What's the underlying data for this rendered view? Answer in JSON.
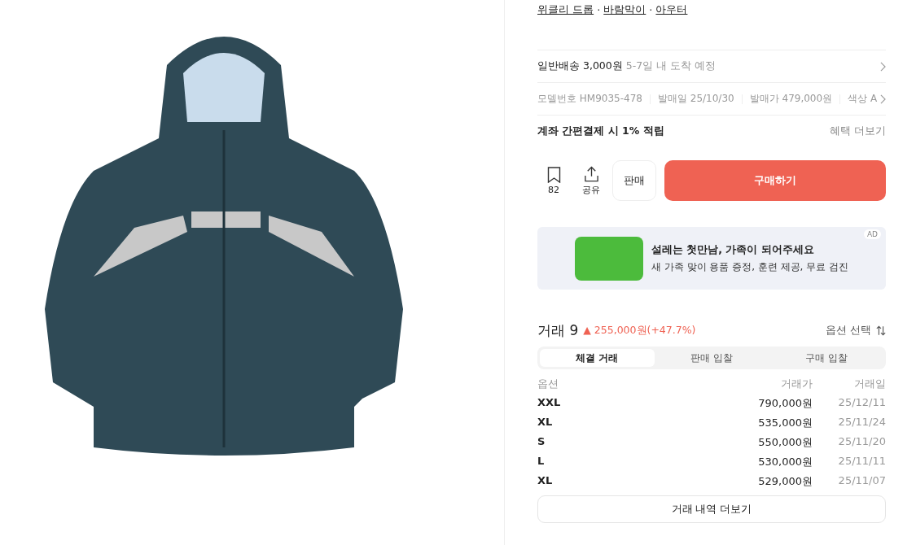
{
  "breadcrumbs": {
    "separator": "·",
    "items": [
      "위클리 드롭",
      "바람막이",
      "아우터"
    ]
  },
  "shipping": {
    "label": "일반배송 3,000원",
    "note": "5-7일 내 도착 예정"
  },
  "specs": [
    "모델번호 HM9035-478",
    "발매일 25/10/30",
    "발매가 479,000원",
    "색상 A"
  ],
  "benefit": {
    "text": "계좌 간편결제 시 1% 적립",
    "link": "혜택 더보기"
  },
  "actions": {
    "bookmark_count": "82",
    "share": "공유",
    "sell": "판매",
    "buy": "구매하기"
  },
  "ad": {
    "badge": "AD",
    "title": "설레는 첫만남, 가족이 되어주세요",
    "subtitle": "새 가족 맞이 용품 증정, 훈련 제공, 무료 검진"
  },
  "trades": {
    "title": "거래 9",
    "change": "▲ 255,000원(+47.7%)",
    "option_select": "옵션 선택",
    "tabs": [
      {
        "label": "체결 거래",
        "selected": true
      },
      {
        "label": "판매 입찰",
        "selected": false
      },
      {
        "label": "구매 입찰",
        "selected": false
      }
    ],
    "columns": [
      "옵션",
      "거래가",
      "거래일"
    ],
    "rows": [
      [
        "XXL",
        "790,000원",
        "25/12/11"
      ],
      [
        "XL",
        "535,000원",
        "25/11/24"
      ],
      [
        "S",
        "550,000원",
        "25/11/20"
      ],
      [
        "L",
        "530,000원",
        "25/11/11"
      ],
      [
        "XL",
        "529,000원",
        "25/11/07"
      ]
    ],
    "more_button": "거래 내역 더보기"
  }
}
